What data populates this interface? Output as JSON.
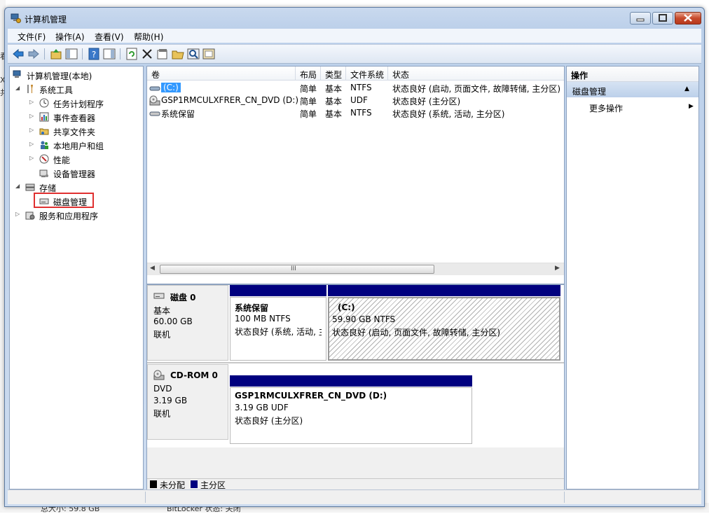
{
  "window": {
    "title": "计算机管理"
  },
  "background": {
    "left_fragments": [
      "看",
      "X",
      "共"
    ],
    "bottom_left": "总大小: 59.8 GB",
    "bottom_right": "BitLocker 状态: 关闭"
  },
  "menu": [
    {
      "label": "文件(F)"
    },
    {
      "label": "操作(A)"
    },
    {
      "label": "查看(V)"
    },
    {
      "label": "帮助(H)"
    }
  ],
  "toolbar_icons": [
    "back-icon",
    "forward-icon",
    "up-folder-icon",
    "show-hide-tree-icon",
    "help-icon",
    "show-hide-action-icon",
    "refresh-icon",
    "delete-icon",
    "properties-icon",
    "open-icon",
    "search-icon",
    "export-icon"
  ],
  "tree": {
    "root": "计算机管理(本地)",
    "system_tools": "系统工具",
    "task_scheduler": "任务计划程序",
    "event_viewer": "事件查看器",
    "shared_folders": "共享文件夹",
    "local_users": "本地用户和组",
    "performance": "性能",
    "device_manager": "设备管理器",
    "storage": "存储",
    "disk_management": "磁盘管理",
    "services_apps": "服务和应用程序"
  },
  "list": {
    "columns": [
      "卷",
      "布局",
      "类型",
      "文件系统",
      "状态"
    ],
    "rows": [
      {
        "volume": "(C:)",
        "layout": "简单",
        "type": "基本",
        "fs": "NTFS",
        "status": "状态良好 (启动, 页面文件, 故障转储, 主分区)"
      },
      {
        "volume": "GSP1RMCULXFRER_CN_DVD (D:)",
        "layout": "简单",
        "type": "基本",
        "fs": "UDF",
        "status": "状态良好 (主分区)"
      },
      {
        "volume": "系统保留",
        "layout": "简单",
        "type": "基本",
        "fs": "NTFS",
        "status": "状态良好 (系统, 活动, 主分区)"
      }
    ],
    "scroll_marker": "III"
  },
  "disks": [
    {
      "name": "磁盘 0",
      "kind": "基本",
      "size": "60.00 GB",
      "state": "联机",
      "partitions": [
        {
          "name": "系统保留",
          "size": "100 MB NTFS",
          "status": "状态良好 (系统, 活动, 主"
        },
        {
          "name": "(C:)",
          "size": "59.90 GB NTFS",
          "status": "状态良好 (启动, 页面文件, 故障转储, 主分区)"
        }
      ]
    },
    {
      "name": "CD-ROM 0",
      "kind": "DVD",
      "size": "3.19 GB",
      "state": "联机",
      "partitions": [
        {
          "name": "GSP1RMCULXFRER_CN_DVD  (D:)",
          "size": "3.19 GB UDF",
          "status": "状态良好 (主分区)"
        }
      ]
    }
  ],
  "legend": [
    {
      "label": "未分配",
      "color": "#000000"
    },
    {
      "label": "主分区",
      "color": "#00007f"
    }
  ],
  "actions": {
    "header": "操作",
    "group": "磁盘管理",
    "more": "更多操作"
  },
  "colors": {
    "primary_partition": "#00007f",
    "selection_box": "#e03030"
  }
}
